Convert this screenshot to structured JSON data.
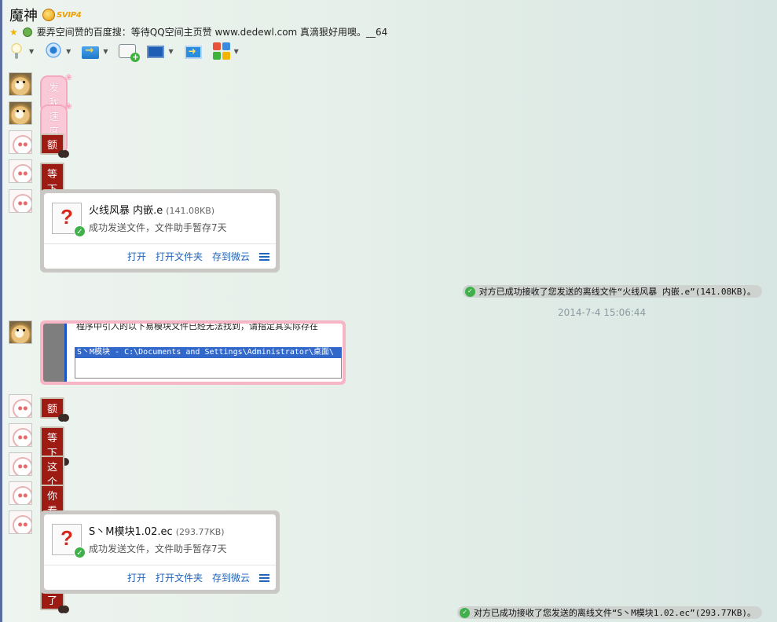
{
  "header": {
    "contact_name": "魔神",
    "vip_badge": "SVIP4",
    "status_text": "要弄空间赞的百度搜：等待QQ空间主页赞 www.dedewl.com  真滴狠好用噢。__64"
  },
  "toolbar": {
    "buttons": [
      {
        "name": "voice",
        "icon": "microphone-icon"
      },
      {
        "name": "video",
        "icon": "webcam-icon"
      },
      {
        "name": "send-file",
        "icon": "folder-transfer-icon"
      },
      {
        "name": "new-discussion",
        "icon": "add-note-icon"
      },
      {
        "name": "remote-desktop",
        "icon": "monitor-icon"
      },
      {
        "name": "share-screen",
        "icon": "share-screen-icon"
      },
      {
        "name": "apps",
        "icon": "apps-grid-icon"
      }
    ]
  },
  "messages": {
    "m1": "发我",
    "m2": "速度",
    "m3": "额",
    "m4": "等下",
    "file1": {
      "name": "火线风暴 内嵌.e",
      "size": "(141.08KB)",
      "status": "成功发送文件，文件助手暂存7天",
      "action_open": "打开",
      "action_open_folder": "打开文件夹",
      "action_save_cloud": "存到微云"
    },
    "sys1": "对方已成功接收了您发送的离线文件“火线风暴 内嵌.e”(141.08KB)。",
    "timestamp": "2014-7-4 15:06:44",
    "image_msg": {
      "cut_text": "程序中引入的以下易模块文件已经无法找到，请指定其实际存在",
      "path_text": "S丶M模块 - C:\\Documents and Settings\\Administrator\\桌面\\"
    },
    "m5": "额",
    "m6": "等下",
    "m7": "这个本来就不用的",
    "m8": "你看一下就知道了",
    "file2": {
      "name": "S丶M模块1.02.ec",
      "size": "(293.77KB)",
      "status": "成功发送文件，文件助手暂存7天",
      "action_open": "打开",
      "action_open_folder": "打开文件夹",
      "action_save_cloud": "存到微云"
    },
    "sys2": "对方已成功接收了您发送的离线文件“S丶M模块1.02.ec”(293.77KB)。"
  },
  "colors": {
    "link": "#2163b9",
    "success": "#3fb04a",
    "bubble_red": "#9d1b13",
    "bubble_pink": "#f9c9d8"
  }
}
